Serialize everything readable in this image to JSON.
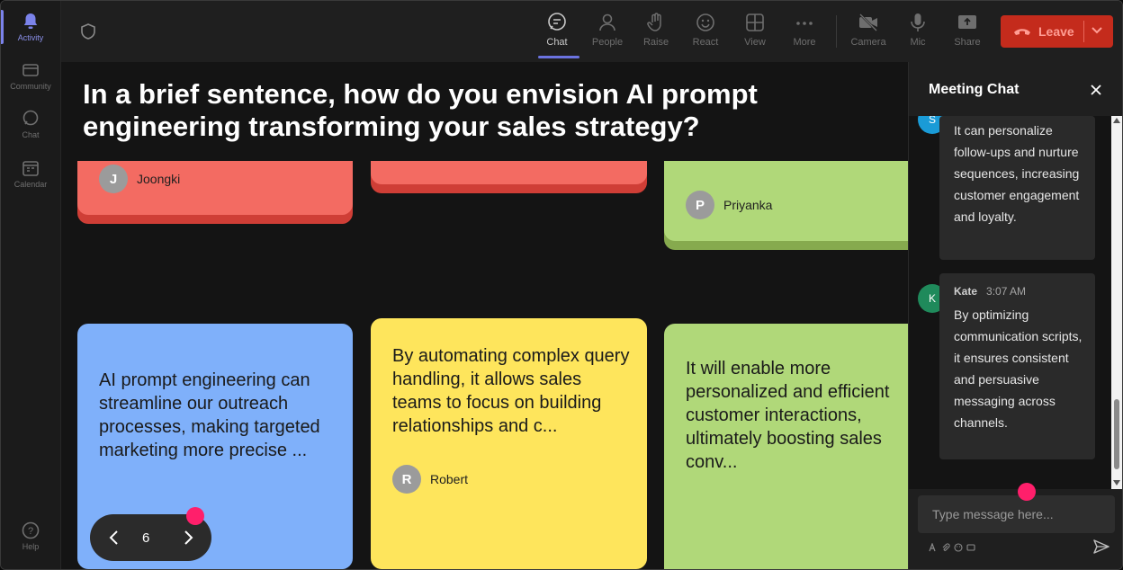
{
  "rail": {
    "items": [
      {
        "label": "Activity",
        "active": true
      },
      {
        "label": "Community",
        "active": false
      },
      {
        "label": "Chat",
        "active": false
      },
      {
        "label": "Calendar",
        "active": false
      }
    ],
    "help": "Help"
  },
  "toolbar": {
    "buttons": [
      {
        "label": "Chat",
        "icon": "chat-icon",
        "active": true
      },
      {
        "label": "People",
        "icon": "people-icon",
        "active": false
      },
      {
        "label": "Raise",
        "icon": "hand-icon",
        "active": false
      },
      {
        "label": "React",
        "icon": "smile-icon",
        "active": false
      },
      {
        "label": "View",
        "icon": "grid-icon",
        "active": false
      },
      {
        "label": "More",
        "icon": "more-icon",
        "active": false
      },
      {
        "label": "Camera",
        "icon": "camera-off-icon",
        "active": false
      },
      {
        "label": "Mic",
        "icon": "mic-icon",
        "active": false
      },
      {
        "label": "Share",
        "icon": "share-icon",
        "active": false
      }
    ],
    "leave_label": "Leave"
  },
  "board": {
    "question": "In a brief sentence, how do you envision AI prompt engineering transforming your sales strategy?",
    "cards": [
      {
        "text": "",
        "author": "Joongki",
        "initial": "J",
        "color": "#f36b62",
        "shadow": "#cf3e36"
      },
      {
        "text": "",
        "author": "",
        "initial": "",
        "color": "#f36b62",
        "shadow": "#cf3e36"
      },
      {
        "text": "",
        "author": "Priyanka",
        "initial": "P",
        "color": "#b0d879",
        "shadow": "#86aa4e"
      },
      {
        "text": "AI prompt engineering can streamline our outreach processes, making targeted marketing more precise ...",
        "author": "",
        "initial": "",
        "color": "#7fb0fa",
        "shadow": "#5b8ede"
      },
      {
        "text": "By automating complex query handling, it allows sales teams to focus on building relationships and c...",
        "author": "Robert",
        "initial": "R",
        "color": "#fee55c",
        "shadow": "#d6bc30"
      },
      {
        "text": "It will enable more personalized and efficient customer interactions, ultimately boosting sales conv...",
        "author": "",
        "initial": "",
        "color": "#b0d879",
        "shadow": "#86aa4e"
      }
    ],
    "page": "6"
  },
  "chat": {
    "title": "Meeting Chat",
    "messages": [
      {
        "initial": "S",
        "name": "",
        "time": "",
        "text": "It can personalize follow-ups and nurture sequences, increasing customer engagement and loyalty.",
        "avatar_color": "#1a9bd7"
      },
      {
        "initial": "K",
        "name": "Kate",
        "time": "3:07 AM",
        "text": "By optimizing communication scripts, it ensures consistent and persuasive messaging across channels.",
        "avatar_color": "#1f8a5b"
      }
    ],
    "input_placeholder": "Type message here..."
  },
  "colors": {
    "accent": "#7b83eb",
    "leave": "#c42b1c",
    "notification_dot": "#ff1f6b"
  }
}
